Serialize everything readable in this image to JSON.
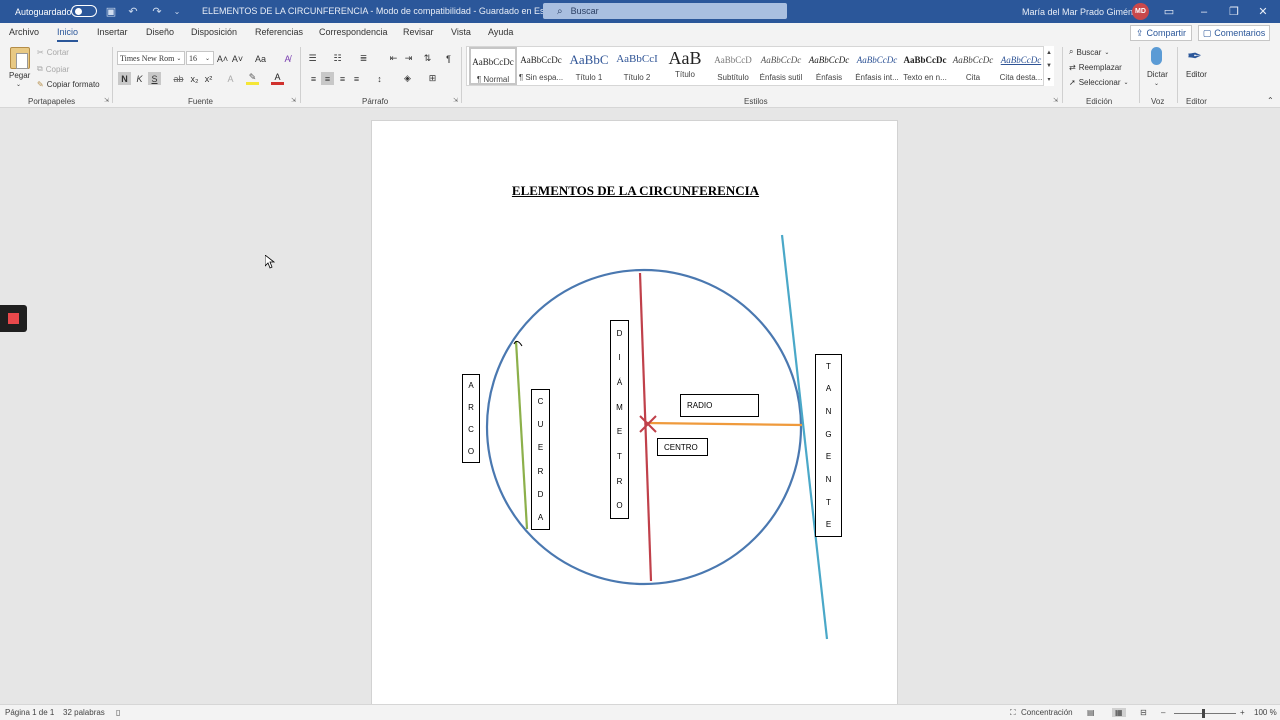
{
  "titlebar": {
    "autosave_label": "Autoguardado",
    "doc_title": "ELEMENTOS DE LA CIRCUNFERENCIA  -  Modo de compatibilidad  -  Guardado en Este PC  ⌄",
    "search_placeholder": "Buscar",
    "user_name": "María del Mar Prado Giménez",
    "user_initials": "MD"
  },
  "tabs": [
    "Archivo",
    "Inicio",
    "Insertar",
    "Diseño",
    "Disposición",
    "Referencias",
    "Correspondencia",
    "Revisar",
    "Vista",
    "Ayuda"
  ],
  "active_tab": "Inicio",
  "share_label": "Compartir",
  "comments_label": "Comentarios",
  "clipboard": {
    "paste": "Pegar",
    "cut": "Cortar",
    "copy": "Copiar",
    "format_painter": "Copiar formato",
    "group": "Portapapeles"
  },
  "font": {
    "name": "Times New Rom",
    "size": "16",
    "bold": "N",
    "italic": "K",
    "underline": "S",
    "strike": "ab",
    "subscript": "x₂",
    "superscript": "x²",
    "group": "Fuente"
  },
  "paragraph": {
    "group": "Párrafo"
  },
  "styles": {
    "items": [
      {
        "sample": "AaBbCcDc",
        "name": "¶ Normal"
      },
      {
        "sample": "AaBbCcDc",
        "name": "¶ Sin espa..."
      },
      {
        "sample": "AaBbC",
        "name": "Título 1"
      },
      {
        "sample": "AaBbCcI",
        "name": "Título 2"
      },
      {
        "sample": "AaB",
        "name": "Título"
      },
      {
        "sample": "AaBbCcD",
        "name": "Subtítulo"
      },
      {
        "sample": "AaBbCcDc",
        "name": "Énfasis sutil"
      },
      {
        "sample": "AaBbCcDc",
        "name": "Énfasis"
      },
      {
        "sample": "AaBbCcDc",
        "name": "Énfasis int..."
      },
      {
        "sample": "AaBbCcDc",
        "name": "Texto en n..."
      },
      {
        "sample": "AaBbCcDc",
        "name": "Cita"
      },
      {
        "sample": "AaBbCcDc",
        "name": "Cita desta..."
      }
    ],
    "group": "Estilos"
  },
  "editing": {
    "find": "Buscar",
    "replace": "Reemplazar",
    "select": "Seleccionar",
    "group": "Edición"
  },
  "voice": {
    "dictate": "Dictar",
    "group": "Voz"
  },
  "editor": {
    "label": "Editor",
    "group": "Editor"
  },
  "document": {
    "heading": "ELEMENTOS DE LA CIRCUNFERENCIA",
    "labels": {
      "arco": [
        "A",
        "R",
        "C",
        "O"
      ],
      "cuerda": [
        "C",
        "U",
        "E",
        "R",
        "D",
        "A"
      ],
      "diametro": [
        "D",
        "I",
        "Á",
        "M",
        "E",
        "T",
        "R",
        "O"
      ],
      "tangente": [
        "T",
        "A",
        "N",
        "G",
        "E",
        "N",
        "T",
        "E"
      ],
      "radio": "RADIO",
      "centro": "CENTRO"
    },
    "colors": {
      "circle": "#4a78b0",
      "diameter": "#c0404a",
      "radius": "#ef9a3c",
      "chord": "#8cb04a",
      "tangent": "#4aa8c8"
    }
  },
  "statusbar": {
    "page": "Página 1 de 1",
    "words": "32 palabras",
    "focus": "Concentración",
    "zoom": "100 %"
  }
}
